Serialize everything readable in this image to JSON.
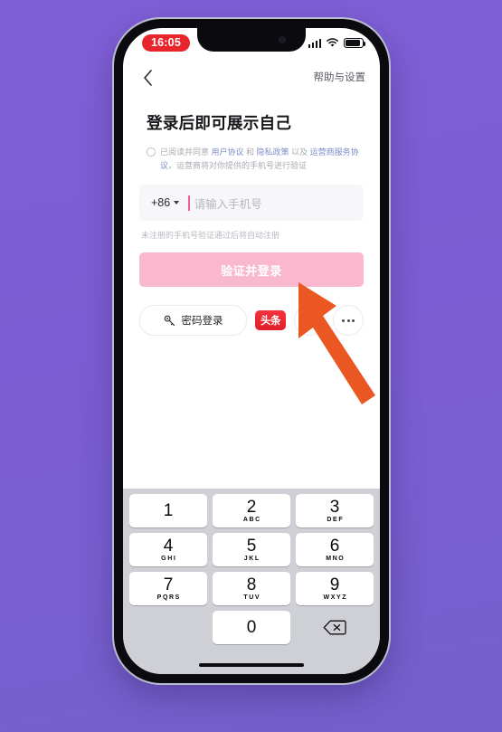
{
  "background": {
    "color": "#7a5fd3"
  },
  "status_bar": {
    "time": "16:05",
    "time_badge_color": "#e8242c",
    "icons": [
      "signal-icon",
      "wifi-icon",
      "battery-icon"
    ]
  },
  "nav_bar": {
    "back_icon": "chevron-left-icon",
    "help_label": "帮助与设置"
  },
  "login": {
    "title": "登录后即可展示自己",
    "agreement": {
      "checked": false,
      "prefix": "已阅读并同意 ",
      "link_user": "用户协议",
      "mid1": " 和 ",
      "link_privacy": "隐私政策",
      "mid2": " 以及 ",
      "link_carrier": "运营商服务协议",
      "suffix": "，运营商将对你提供的手机号进行验证"
    },
    "phone_input": {
      "country_code": "+86",
      "placeholder": "请输入手机号",
      "value": "",
      "cursor_color": "#f06292"
    },
    "hint": "未注册的手机号验证通过后将自动注册",
    "primary_button": {
      "label": "验证并登录",
      "color": "#f9b8cd"
    },
    "password_button": {
      "label": "密码登录",
      "icon": "key-icon"
    },
    "social": [
      {
        "name": "toutiao-login",
        "label": "头条",
        "color": "#e01f28"
      },
      {
        "name": "apple-login",
        "label": "apple-icon"
      },
      {
        "name": "more-login",
        "label": "more-dots-icon"
      }
    ]
  },
  "keyboard": {
    "rows": [
      [
        {
          "num": "1",
          "sub": ""
        },
        {
          "num": "2",
          "sub": "ABC"
        },
        {
          "num": "3",
          "sub": "DEF"
        }
      ],
      [
        {
          "num": "4",
          "sub": "GHI"
        },
        {
          "num": "5",
          "sub": "JKL"
        },
        {
          "num": "6",
          "sub": "MNO"
        }
      ],
      [
        {
          "num": "7",
          "sub": "PQRS"
        },
        {
          "num": "8",
          "sub": "TUV"
        },
        {
          "num": "9",
          "sub": "WXYZ"
        }
      ],
      [
        {
          "num": "",
          "sub": ""
        },
        {
          "num": "0",
          "sub": ""
        },
        {
          "num": "delete-icon",
          "sub": ""
        }
      ]
    ]
  },
  "annotation": {
    "arrow_color": "#ea5723",
    "points_to": "toutiao-login"
  }
}
